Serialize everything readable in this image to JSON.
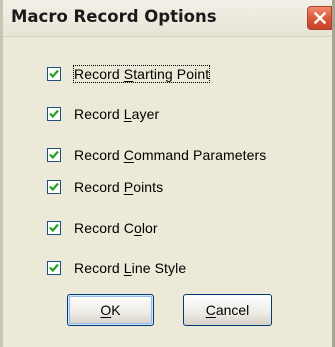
{
  "window": {
    "title": "Macro Record Options",
    "close_icon": "close-icon"
  },
  "options": [
    {
      "pre": "Record ",
      "key": "S",
      "post": "tarting Point",
      "checked": true
    },
    {
      "pre": "Record ",
      "key": "L",
      "post": "ayer",
      "checked": true
    },
    {
      "pre": "Record ",
      "key": "C",
      "post": "ommand Parameters",
      "checked": true
    },
    {
      "pre": "Record ",
      "key": "P",
      "post": "oints",
      "checked": true
    },
    {
      "pre": "Record C",
      "key": "o",
      "post": "lor",
      "checked": true
    },
    {
      "pre": "Record ",
      "key": "L",
      "post": "ine Style",
      "checked": true
    }
  ],
  "buttons": {
    "ok": {
      "key": "O",
      "rest": "K"
    },
    "cancel": {
      "key": "C",
      "rest": "ancel"
    }
  },
  "colors": {
    "dialog_bg": "#ece9d8",
    "checkbox_border": "#1c5180",
    "checkmark": "#21a121",
    "close_button": "#d9553a"
  }
}
